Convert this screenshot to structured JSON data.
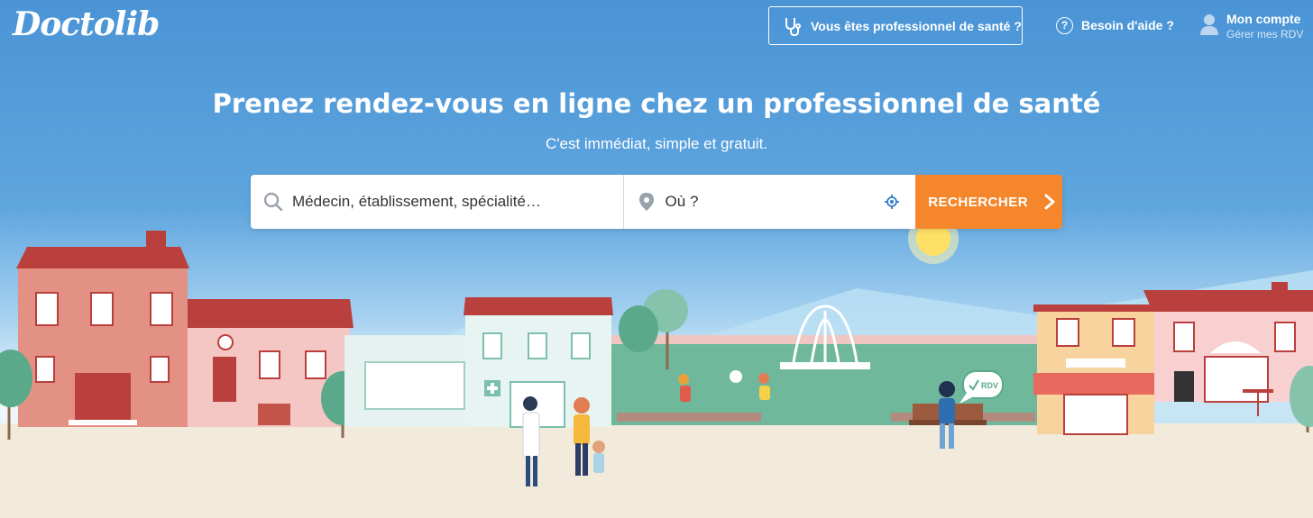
{
  "header": {
    "logo": "Doctolib",
    "pro_button": "Vous êtes professionnel de santé ?",
    "help_label": "Besoin d'aide ?",
    "account_title": "Mon compte",
    "account_subtitle": "Gérer mes RDV"
  },
  "hero": {
    "title": "Prenez rendez-vous en ligne chez un professionnel de santé",
    "subtitle": "C'est immédiat, simple et gratuit."
  },
  "search": {
    "what_placeholder": "Médecin, établissement, spécialité…",
    "where_placeholder": "Où ?",
    "button_label": "RECHERCHER"
  },
  "illustration": {
    "speech_bubble": "RDV"
  },
  "colors": {
    "brand_blue": "#4a94d6",
    "cta_orange": "#f5862c",
    "roof_red": "#b9403c"
  },
  "icons": [
    "stethoscope-icon",
    "help-icon",
    "user-icon",
    "search-icon",
    "location-pin-icon",
    "geolocate-icon",
    "chevron-right-icon"
  ]
}
